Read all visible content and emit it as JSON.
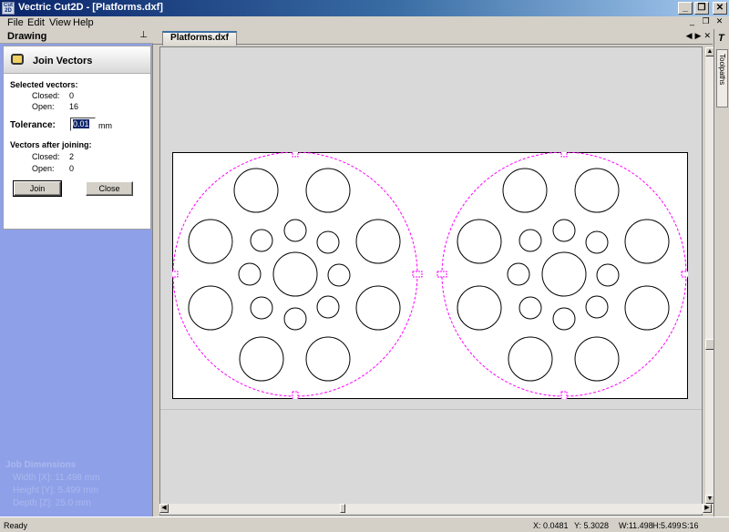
{
  "window": {
    "icon_text": "Cut 2D",
    "title": "Vectric Cut2D - [Platforms.dxf]"
  },
  "menu": [
    "File",
    "Edit",
    "View",
    "Help"
  ],
  "drawing_panel": {
    "title": "Drawing",
    "form_title": "Join Vectors",
    "selected_heading": "Selected vectors:",
    "selected_closed_label": "Closed:",
    "selected_closed": "0",
    "selected_open_label": "Open:",
    "selected_open": "16",
    "tolerance_label": "Tolerance:",
    "tolerance_value": "0.01",
    "tolerance_unit": "mm",
    "after_heading": "Vectors after joining:",
    "after_closed_label": "Closed:",
    "after_closed": "2",
    "after_open_label": "Open:",
    "after_open": "0",
    "join_button": "Join",
    "close_button": "Close"
  },
  "job_dimensions": {
    "heading": "Job Dimensions",
    "width": "Width  [X]: 11.498 mm",
    "height": "Height [Y]: 5.499 mm",
    "depth": "Depth  [Z]: 25.0 mm"
  },
  "document": {
    "tab": "Platforms.dxf"
  },
  "right_strip": {
    "label": "Toolpaths"
  },
  "statusbar": {
    "ready": "Ready",
    "x": "X:  0.0481",
    "y": "Y:  5.3028",
    "w": "W:11.498",
    "h": "H:5.499",
    "s": "S:16"
  },
  "colors": {
    "dashed_outline": "#ff00ff",
    "circle_stroke": "#000000",
    "title_gradient_start": "#0a246a"
  }
}
